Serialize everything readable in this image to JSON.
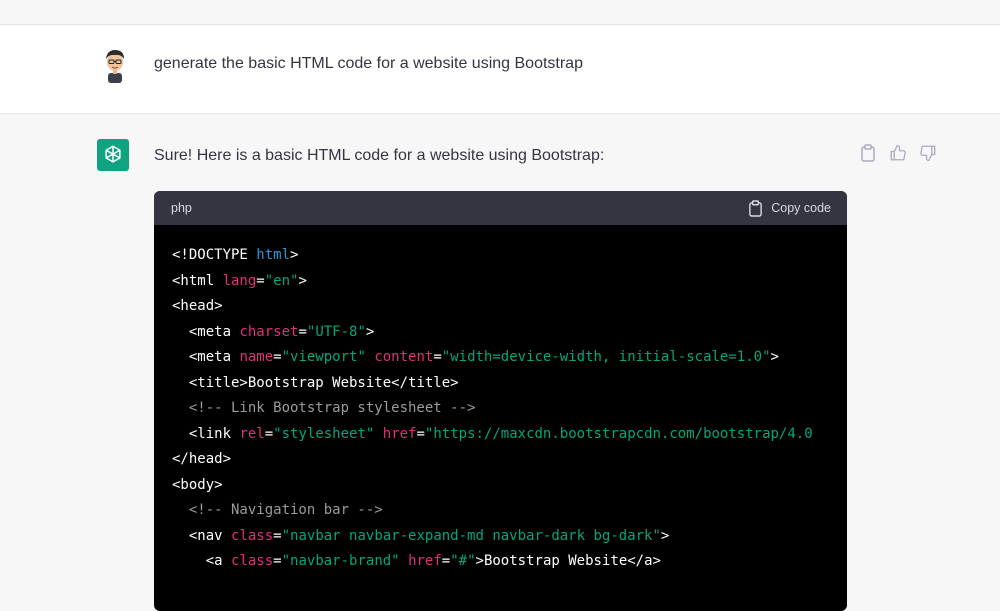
{
  "user": {
    "prompt": "generate the basic HTML code for a website using Bootstrap"
  },
  "assistant": {
    "intro": "Sure! Here is a basic HTML code for a website using Bootstrap:",
    "actions": [
      "copy-icon",
      "thumbs-up-icon",
      "thumbs-down-icon"
    ]
  },
  "code": {
    "language": "php",
    "copy_label": "Copy code",
    "lines": [
      [
        [
          "plain",
          "<!DOCTYPE "
        ],
        [
          "kw",
          "html"
        ],
        [
          "plain",
          ">"
        ]
      ],
      [
        [
          "tag",
          "<html "
        ],
        [
          "attr",
          "lang"
        ],
        [
          "plain",
          "="
        ],
        [
          "str",
          "\"en\""
        ],
        [
          "plain",
          ">"
        ]
      ],
      [
        [
          "tag",
          "<head>"
        ]
      ],
      [
        [
          "tag",
          "  <meta "
        ],
        [
          "attr",
          "charset"
        ],
        [
          "plain",
          "="
        ],
        [
          "str",
          "\"UTF-8\""
        ],
        [
          "plain",
          ">"
        ]
      ],
      [
        [
          "tag",
          "  <meta "
        ],
        [
          "attr",
          "name"
        ],
        [
          "plain",
          "="
        ],
        [
          "str",
          "\"viewport\""
        ],
        [
          "plain",
          " "
        ],
        [
          "attr",
          "content"
        ],
        [
          "plain",
          "="
        ],
        [
          "str",
          "\"width=device-width, initial-scale=1.0\""
        ],
        [
          "plain",
          ">"
        ]
      ],
      [
        [
          "tag",
          "  <title>"
        ],
        [
          "plain",
          "Bootstrap Website"
        ],
        [
          "tag",
          "</title>"
        ]
      ],
      [
        [
          "comment",
          "  <!-- Link Bootstrap stylesheet -->"
        ]
      ],
      [
        [
          "tag",
          "  <link "
        ],
        [
          "attr",
          "rel"
        ],
        [
          "plain",
          "="
        ],
        [
          "str",
          "\"stylesheet\""
        ],
        [
          "plain",
          " "
        ],
        [
          "attr",
          "href"
        ],
        [
          "plain",
          "="
        ],
        [
          "str",
          "\"https://maxcdn.bootstrapcdn.com/bootstrap/4.0"
        ]
      ],
      [
        [
          "tag",
          "</head>"
        ]
      ],
      [
        [
          "tag",
          "<body>"
        ]
      ],
      [
        [
          "comment",
          "  <!-- Navigation bar -->"
        ]
      ],
      [
        [
          "tag",
          "  <nav "
        ],
        [
          "attr",
          "class"
        ],
        [
          "plain",
          "="
        ],
        [
          "str",
          "\"navbar navbar-expand-md navbar-dark bg-dark\""
        ],
        [
          "plain",
          ">"
        ]
      ],
      [
        [
          "tag",
          "    <a "
        ],
        [
          "attr",
          "class"
        ],
        [
          "plain",
          "="
        ],
        [
          "str",
          "\"navbar-brand\""
        ],
        [
          "plain",
          " "
        ],
        [
          "attr",
          "href"
        ],
        [
          "plain",
          "="
        ],
        [
          "str",
          "\"#\""
        ],
        [
          "plain",
          ">"
        ],
        [
          "plain",
          "Bootstrap Website"
        ],
        [
          "tag",
          "</a>"
        ]
      ]
    ]
  },
  "colors": {
    "accent": "#10a37f",
    "keyword": "#2e95d3",
    "attribute": "#df3079",
    "string": "#00a67d",
    "comment": "#9b9b9b"
  }
}
